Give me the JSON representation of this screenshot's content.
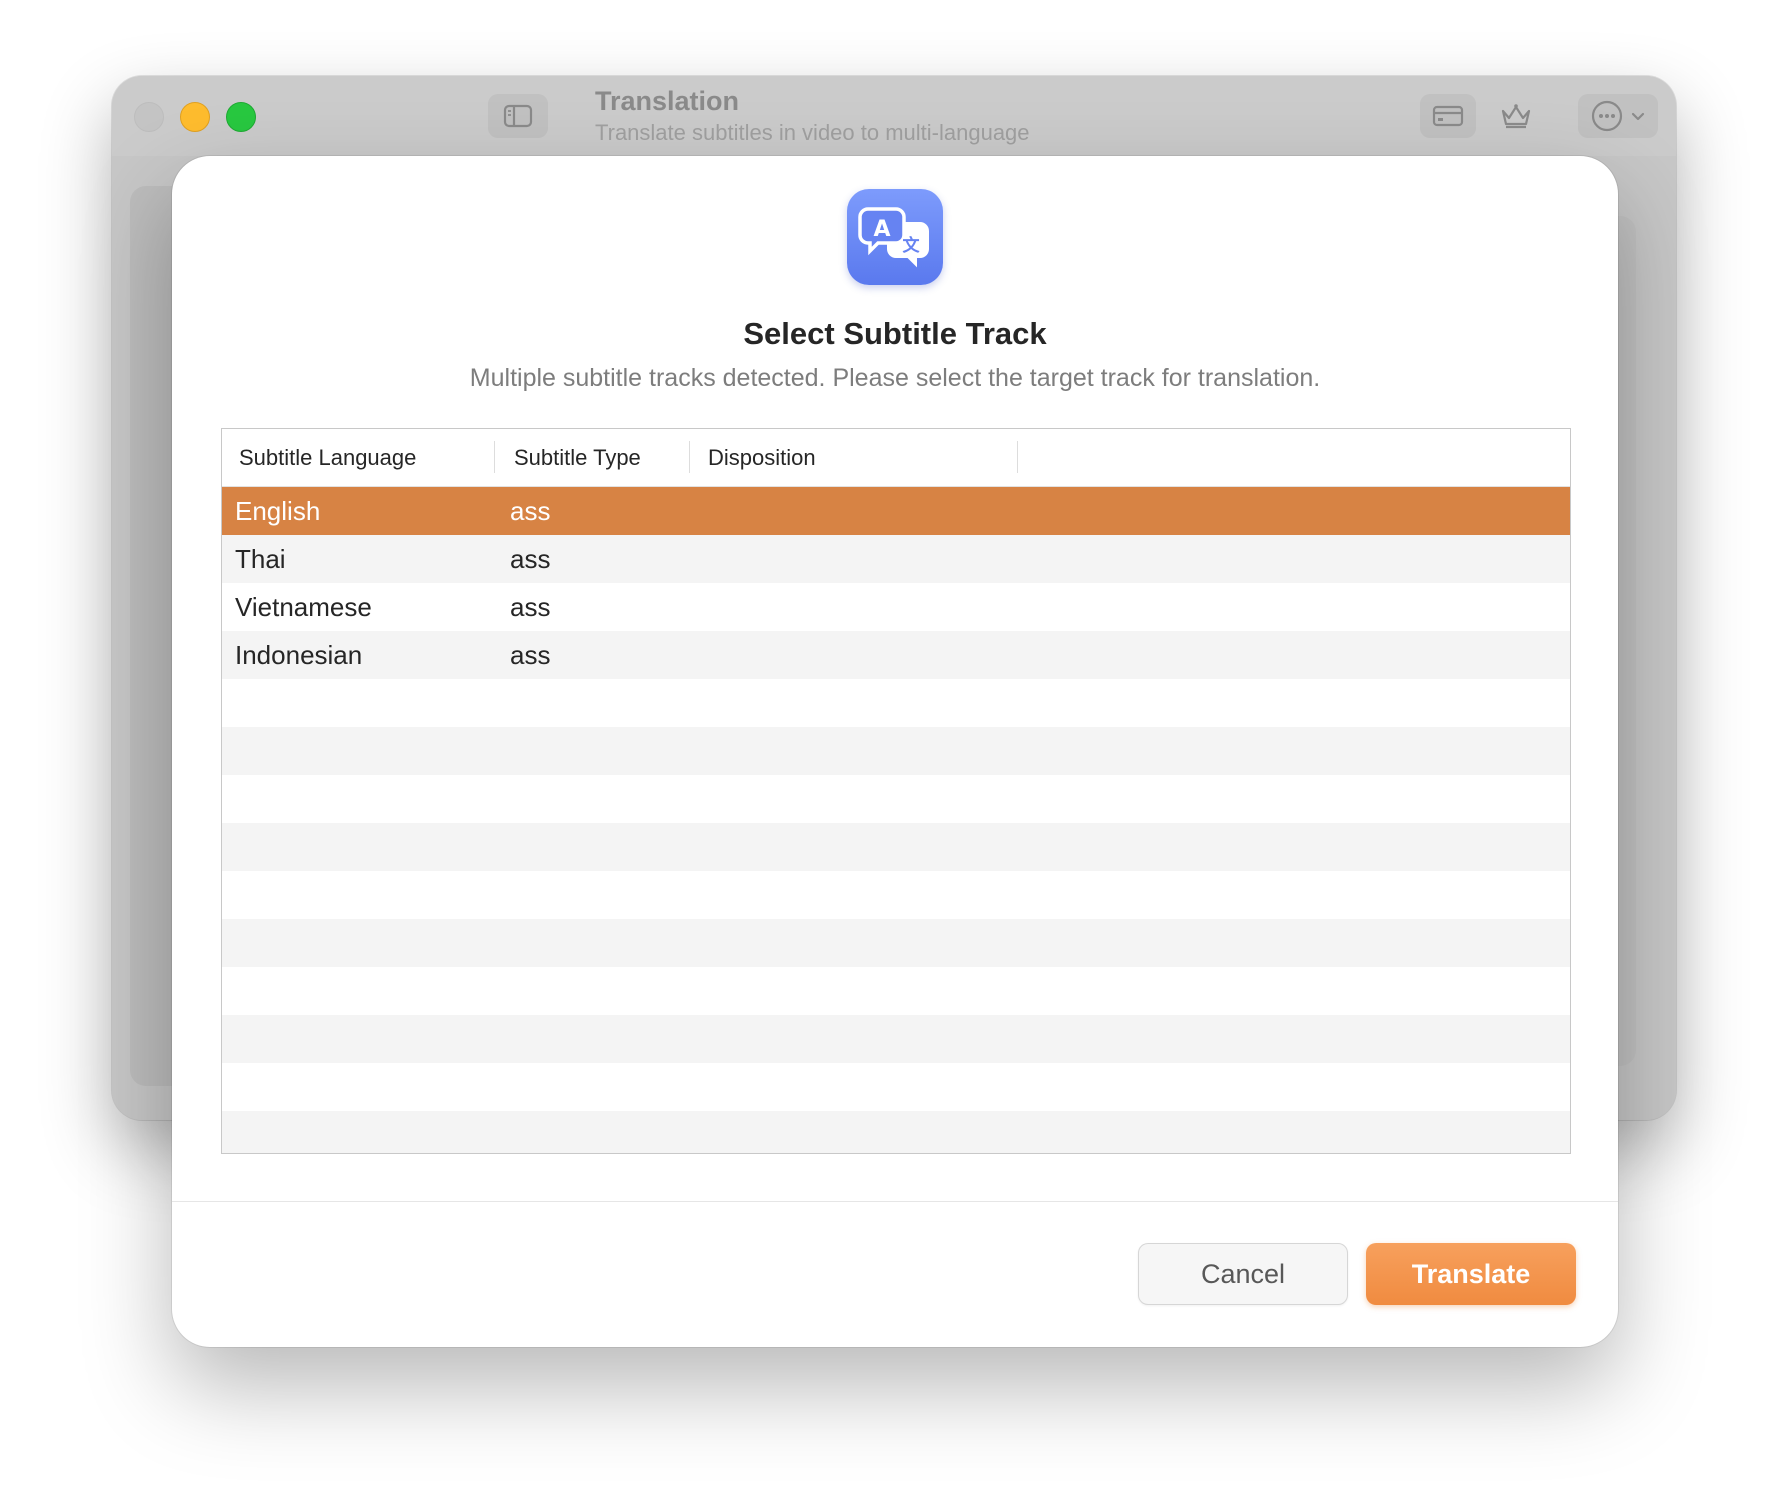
{
  "window": {
    "title": "Translation",
    "subtitle": "Translate subtitles in video to multi-language",
    "toolbar_icons": [
      "sidebar-toggle-icon",
      "card-icon",
      "crown-icon",
      "more-icon",
      "chevron-down-icon"
    ]
  },
  "dialog": {
    "icon": "translate-icon",
    "title": "Select Subtitle Track",
    "subtitle": "Multiple subtitle tracks detected. Please select the target track for translation.",
    "table": {
      "columns": [
        "Subtitle Language",
        "Subtitle Type",
        "Disposition"
      ],
      "rows": [
        {
          "language": "English",
          "type": "ass",
          "disposition": "",
          "selected": true
        },
        {
          "language": "Thai",
          "type": "ass",
          "disposition": "",
          "selected": false
        },
        {
          "language": "Vietnamese",
          "type": "ass",
          "disposition": "",
          "selected": false
        },
        {
          "language": "Indonesian",
          "type": "ass",
          "disposition": "",
          "selected": false
        }
      ]
    },
    "buttons": {
      "cancel": "Cancel",
      "translate": "Translate"
    }
  },
  "colors": {
    "selected_row": "#d78344",
    "primary_button": "#f08b40",
    "app_icon": "#6a88f5"
  }
}
